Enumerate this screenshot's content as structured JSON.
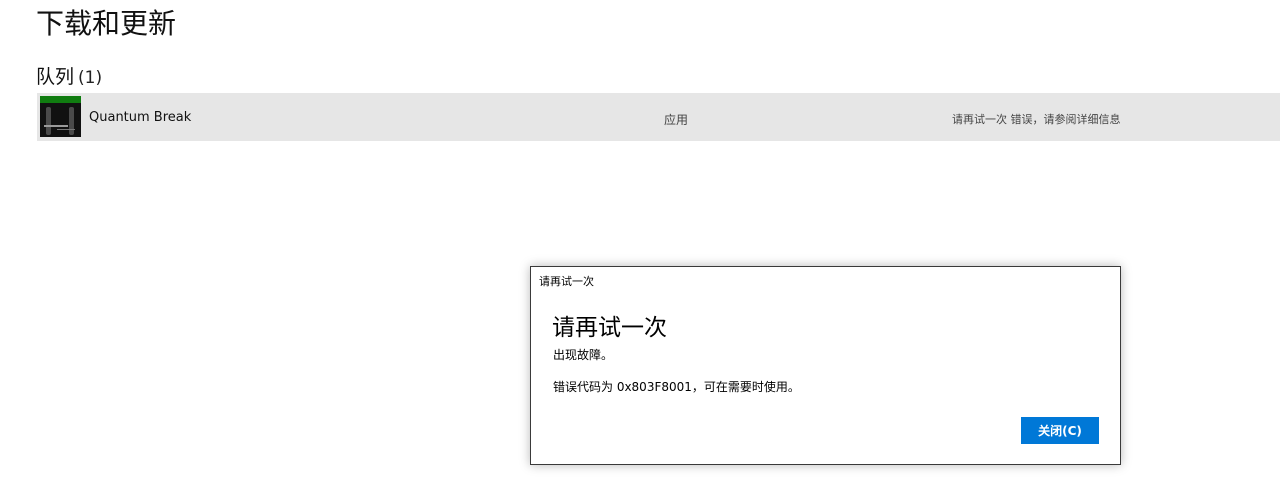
{
  "page": {
    "title": "下载和更新"
  },
  "queue": {
    "heading": "队列",
    "count": "(1)",
    "items": [
      {
        "name": "Quantum Break",
        "type": "应用",
        "status": "请再试一次 错误，请参阅详细信息",
        "thumbnail_icon": "quantum-break-cover-icon"
      }
    ]
  },
  "dialog": {
    "caption": "请再试一次",
    "heading": "请再试一次",
    "message": "出现故障。",
    "error_code_text": "错误代码为 0x803F8001，可在需要时使用。",
    "close_label": "关闭(C)"
  },
  "colors": {
    "accent": "#0078d7",
    "row_background": "#e6e6e6",
    "xbox_green": "#107c10"
  }
}
